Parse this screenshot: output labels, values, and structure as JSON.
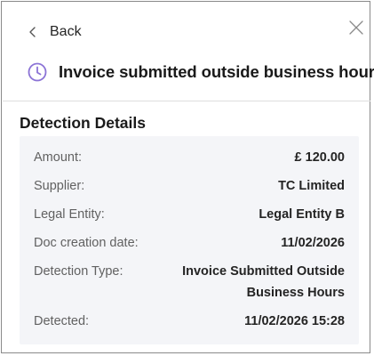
{
  "header": {
    "back_label": "Back",
    "title": "Invoice submitted outside business hours"
  },
  "icons": {
    "back": "chevron-left-icon",
    "close": "close-icon",
    "title": "clock-icon"
  },
  "colors": {
    "accent": "#8b73d6",
    "details_background": "#f4f5f8"
  },
  "section": {
    "title": "Detection Details"
  },
  "details": [
    {
      "label": "Amount:",
      "value": "£ 120.00"
    },
    {
      "label": "Supplier:",
      "value": "TC Limited"
    },
    {
      "label": "Legal Entity:",
      "value": "Legal Entity B"
    },
    {
      "label": "Doc creation date:",
      "value": "11/02/2026"
    },
    {
      "label": "Detection Type:",
      "value": "Invoice Submitted Outside Business Hours"
    },
    {
      "label": "Detected:",
      "value": "11/02/2026 15:28"
    }
  ]
}
